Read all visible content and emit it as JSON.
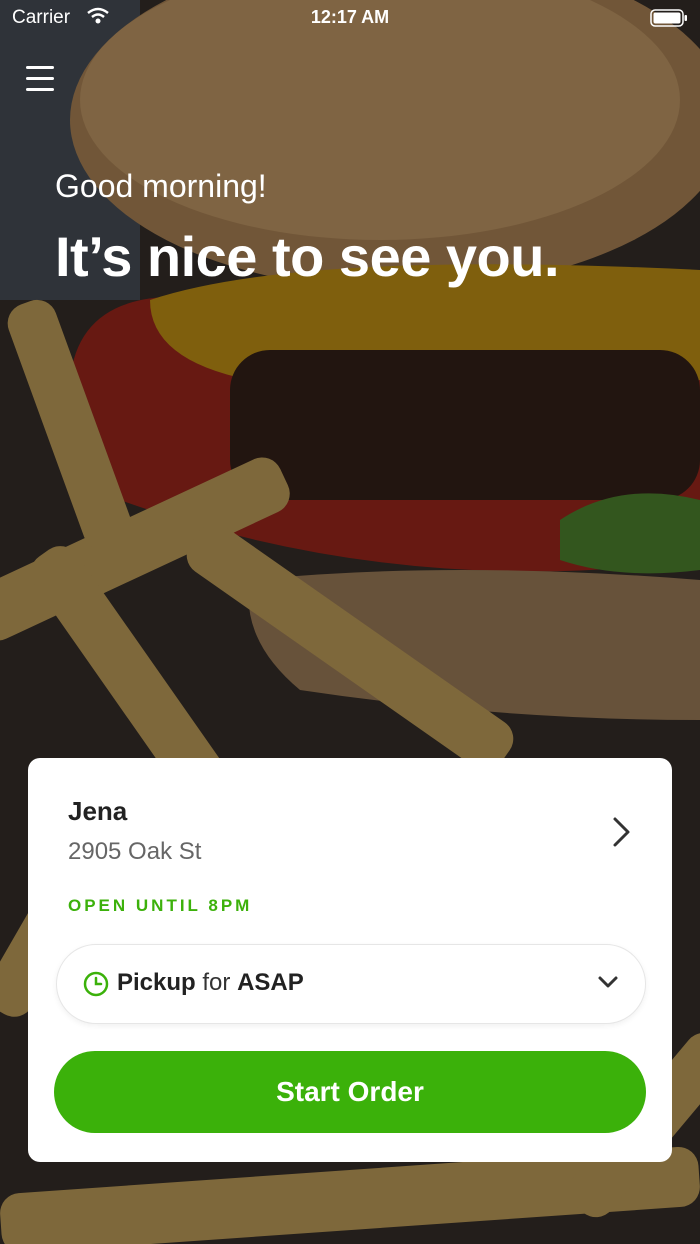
{
  "status_bar": {
    "carrier": "Carrier",
    "time": "12:17 AM"
  },
  "hero": {
    "greeting": "Good morning!",
    "headline": "It’s nice to see you."
  },
  "store_card": {
    "name": "Jena",
    "address": "2905 Oak St",
    "hours": "OPEN UNTIL 8PM",
    "order_mode": {
      "type": "Pickup",
      "connector": "for",
      "time": "ASAP"
    },
    "start_button": "Start Order"
  },
  "colors": {
    "accent_green": "#3bb10a",
    "hours_green": "#3cb10b"
  },
  "icons": [
    "wifi-icon",
    "battery-icon",
    "menu-icon",
    "chevron-right-icon",
    "clock-icon",
    "chevron-down-icon"
  ]
}
